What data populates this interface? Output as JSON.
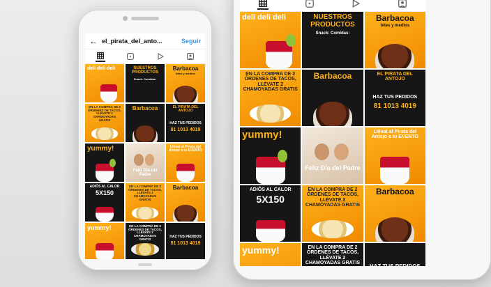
{
  "profile": {
    "username": "el_pirata_del_anto...",
    "follow_label": "Seguir"
  },
  "colors": {
    "accent": "#ffb21a",
    "dark": "#161616",
    "link": "#3897f0"
  },
  "icons": [
    "back-arrow-icon",
    "grid-icon",
    "reels-icon",
    "play-icon",
    "tagged-icon"
  ],
  "posts": {
    "p1": "deli deli deli",
    "p2": "NUESTROS PRODUCTOS",
    "p2b": "Snack: Comidas:",
    "p3": "Barbacoa",
    "p3b": "bites y medios",
    "p4": "EN LA COMPRA DE 2 ÓRDENES DE TACOS, LLÉVATE 2 CHAMOYADAS GRATIS",
    "p5": "Barbacoa",
    "p6": "EL PIRATA DEL ANTOJO",
    "p6b": "HAZ TUS PEDIDOS",
    "p6c": "81 1013 4019",
    "p7": "yummy!",
    "p8": "Feliz Día del Padre",
    "p9": "Llévat al Pirata del Antojo a tu EVENTO",
    "p10": "ADIÓS AL CALOR",
    "p10b": "5X150",
    "p11": "EN LA COMPRA DE 2 ÓRDENES DE TACOS, LLÉVATE 2 CHAMOYADAS GRATIS",
    "p12": "Barbacoa",
    "p13": "yummy!",
    "p14": "EN LA COMPRA DE 2 ÓRDENES DE TACOS, LLÉVATE 2 CHAMOYADAS GRATIS",
    "p15": "HAZ TUS PEDIDOS",
    "p15b": "81 1013 4019"
  }
}
